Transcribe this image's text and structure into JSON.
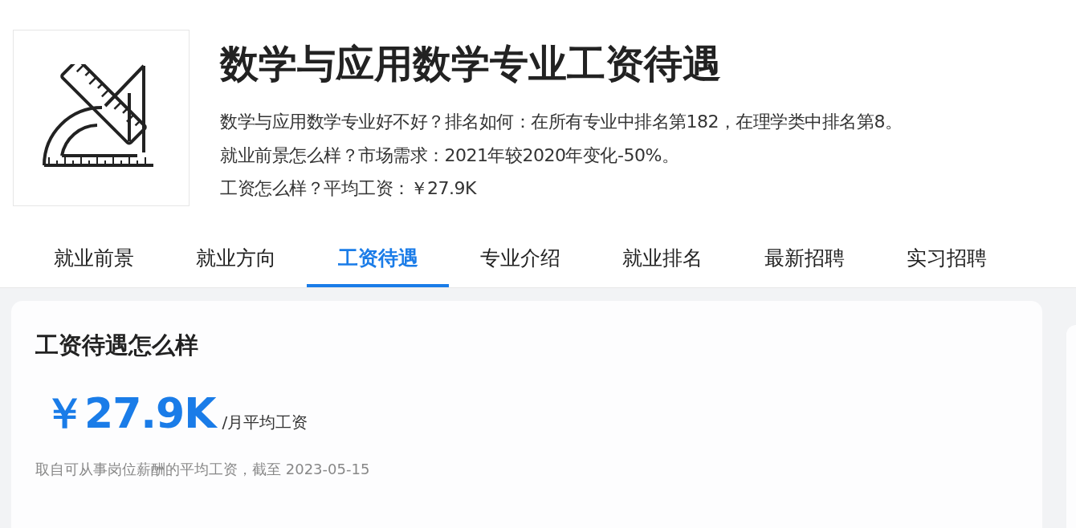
{
  "header": {
    "title": "数学与应用数学专业工资待遇",
    "lines": [
      "数学与应用数学专业好不好？排名如何：在所有专业中排名第182，在理学类中排名第8。",
      "就业前景怎么样？市场需求：2021年较2020年变化-50%。",
      "工资怎么样？平均工资：￥27.9K"
    ]
  },
  "tabs": [
    {
      "label": "就业前景",
      "selected": false
    },
    {
      "label": "就业方向",
      "selected": false
    },
    {
      "label": "工资待遇",
      "selected": true
    },
    {
      "label": "专业介绍",
      "selected": false
    },
    {
      "label": "就业排名",
      "selected": false
    },
    {
      "label": "最新招聘",
      "selected": false
    },
    {
      "label": "实习招聘",
      "selected": false
    }
  ],
  "salary_card": {
    "title": "工资待遇怎么样",
    "amount": "￥27.9K",
    "unit": "/月平均工资",
    "note": "取自可从事岗位薪酬的平均工资，截至 2023-05-15"
  }
}
